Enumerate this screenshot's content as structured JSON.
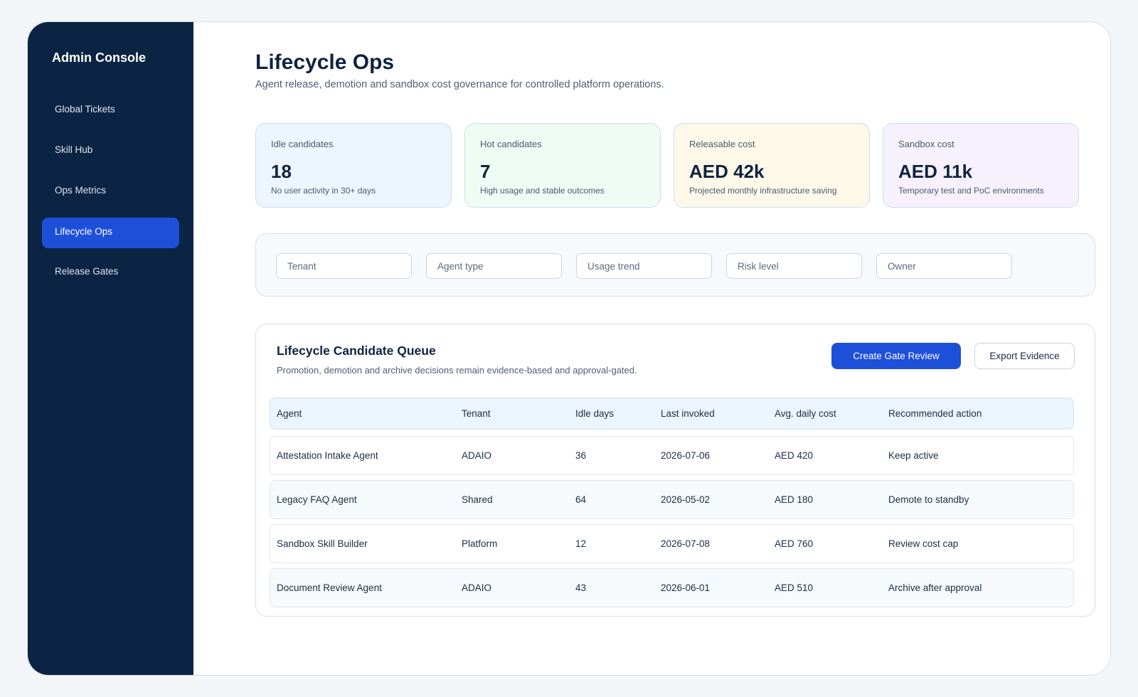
{
  "sidebar": {
    "brand": "Admin Console",
    "items": [
      {
        "label": "Global Tickets",
        "active": false
      },
      {
        "label": "Skill Hub",
        "active": false
      },
      {
        "label": "Ops Metrics",
        "active": false
      },
      {
        "label": "Lifecycle Ops",
        "active": true
      },
      {
        "label": "Release Gates",
        "active": false
      }
    ]
  },
  "header": {
    "title": "Lifecycle Ops",
    "subtitle": "Agent release, demotion and sandbox cost governance for controlled platform operations."
  },
  "kpis": [
    {
      "label": "Idle candidates",
      "value": "18",
      "note": "No user activity in 30+ days",
      "bg": "#edf5fe"
    },
    {
      "label": "Hot candidates",
      "value": "7",
      "note": "High usage and stable outcomes",
      "bg": "#eefcf3"
    },
    {
      "label": "Releasable cost",
      "value": "AED 42k",
      "note": "Projected monthly infrastructure saving",
      "bg": "#fef8e9"
    },
    {
      "label": "Sandbox cost",
      "value": "AED 11k",
      "note": "Temporary test and PoC environments",
      "bg": "#f6f1fd"
    }
  ],
  "filters": {
    "tenant": {
      "placeholder": "Tenant"
    },
    "agent_type": {
      "placeholder": "Agent type"
    },
    "usage_trend": {
      "placeholder": "Usage trend"
    },
    "risk_level": {
      "placeholder": "Risk level"
    },
    "owner": {
      "placeholder": "Owner"
    }
  },
  "queue": {
    "title": "Lifecycle Candidate Queue",
    "subtitle": "Promotion, demotion and archive decisions remain evidence-based and approval-gated.",
    "create_label": "Create Gate Review",
    "export_label": "Export Evidence",
    "columns": [
      "Agent",
      "Tenant",
      "Idle days",
      "Last invoked",
      "Avg. daily cost",
      "Recommended action"
    ],
    "rows": [
      [
        "Attestation Intake Agent",
        "ADAIO",
        "36",
        "2026-07-06",
        "AED 420",
        "Keep active"
      ],
      [
        "Legacy FAQ Agent",
        "Shared",
        "64",
        "2026-05-02",
        "AED 180",
        "Demote to standby"
      ],
      [
        "Sandbox Skill Builder",
        "Platform",
        "12",
        "2026-07-08",
        "AED 760",
        "Review cost cap"
      ],
      [
        "Document Review Agent",
        "ADAIO",
        "43",
        "2026-06-01",
        "AED 510",
        "Archive after approval"
      ]
    ]
  },
  "colors": {
    "sidebar": "#0c2444",
    "accent": "#1e4fd8",
    "text": "#0f2340"
  }
}
